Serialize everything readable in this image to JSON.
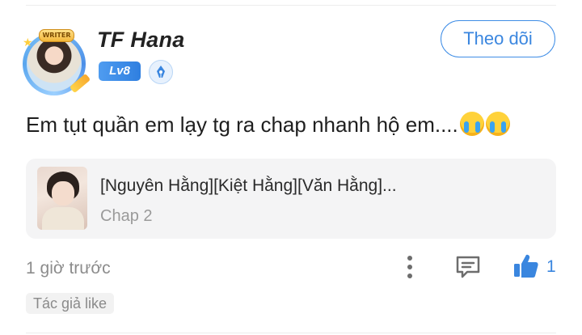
{
  "user": {
    "name": "TF Hana",
    "level": "Lv8",
    "avatar_badge": "WRITER",
    "follow_label": "Theo dõi"
  },
  "comment": {
    "text": "Em tụt quần em lạy tg ra chap nhanh hộ em....",
    "emoji_count": 2
  },
  "story": {
    "title": "[Nguyên Hằng][Kiệt Hằng][Văn Hằng]...",
    "chapter": "Chap 2"
  },
  "meta": {
    "time_ago": "1 giờ trước",
    "like_count": "1",
    "author_like": "Tác giả like"
  },
  "colors": {
    "accent": "#3a86df",
    "card_bg": "#f4f4f5",
    "muted_text": "#8c8c8c"
  },
  "icons": [
    "star-icon",
    "pen-icon",
    "more-vertical-icon",
    "comment-icon",
    "thumbs-up-icon",
    "crying-emoji-icon"
  ]
}
